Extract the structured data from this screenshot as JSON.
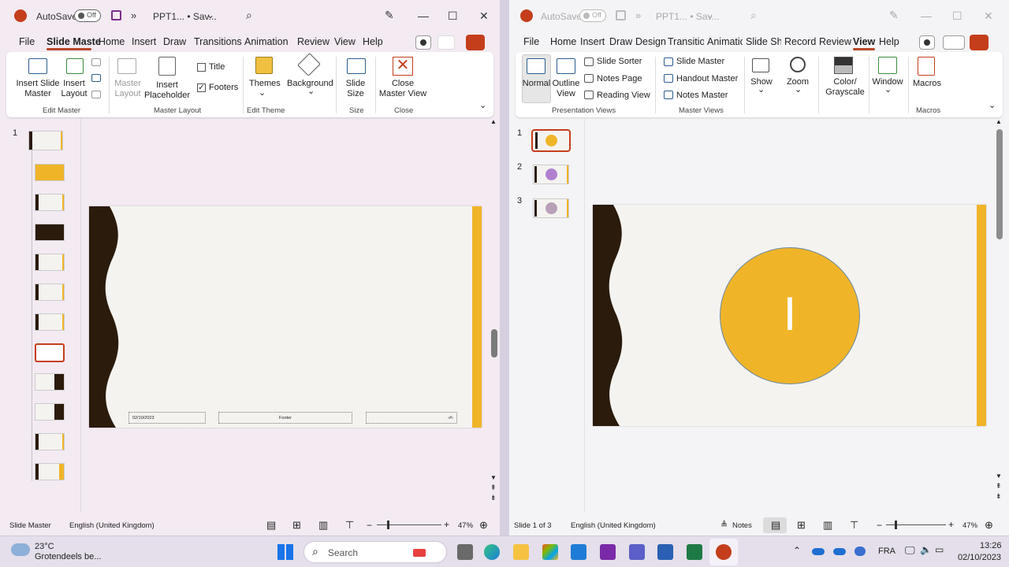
{
  "left": {
    "title": {
      "autosave": "AutoSave",
      "toggle": "Off",
      "doc": "PPT1... • Sav..."
    },
    "tabs": [
      "File",
      "Slide Maste",
      "Home",
      "Insert",
      "Draw",
      "Transitions",
      "Animations",
      "Review",
      "View",
      "Help"
    ],
    "ribbon": {
      "insert_slide_master": "Insert Slide Master",
      "insert_layout": "Insert Layout",
      "master_layout": "Master Layout",
      "insert_placeholder": "Insert Placeholder",
      "title_check": "Title",
      "footers_check": "Footers",
      "themes": "Themes",
      "background": "Background",
      "slide_size": "Slide Size",
      "close_master": "Close Master View",
      "groups": {
        "edit_master": "Edit Master",
        "master_layout": "Master Layout",
        "edit_theme": "Edit Theme",
        "size": "Size",
        "close": "Close"
      }
    },
    "slide_number": "1",
    "slide": {
      "date": "02/10/2023",
      "footer": "Footer",
      "page": "‹#›"
    },
    "status": {
      "slide": "Slide Master",
      "lang": "English (United Kingdom)",
      "zoom": "47%"
    }
  },
  "right": {
    "title": {
      "autosave": "AutoSave",
      "toggle": "Off",
      "doc": "PPT1... • Sav..."
    },
    "tabs": [
      "File",
      "Home",
      "Insert",
      "Draw",
      "Design",
      "Transitio",
      "Animatic",
      "Slide Sho",
      "Record",
      "Review",
      "View",
      "Help"
    ],
    "ribbon": {
      "normal": "Normal",
      "outline_view": "Outline View",
      "slide_sorter": "Slide Sorter",
      "notes_page": "Notes Page",
      "reading_view": "Reading View",
      "slide_master": "Slide Master",
      "handout_master": "Handout Master",
      "notes_master": "Notes Master",
      "show": "Show",
      "zoom": "Zoom",
      "color": "Color/ Grayscale",
      "window": "Window",
      "macros": "Macros",
      "groups": {
        "presentation_views": "Presentation Views",
        "master_views": "Master Views",
        "macros": "Macros"
      }
    },
    "slide_numbers": [
      "1",
      "2",
      "3"
    ],
    "circle_text": "I",
    "status": {
      "slide": "Slide 1 of 3",
      "lang": "English (United Kingdom)",
      "notes": "Notes",
      "zoom": "47%"
    }
  },
  "taskbar": {
    "temp": "23°C",
    "weather": "Grotendeels be...",
    "search": "Search",
    "lang": "FRA",
    "time": "13:26",
    "date": "02/10/2023"
  },
  "colors": {
    "accent": "#b7472a",
    "gold": "#f0b429",
    "dark": "#2a1b0c",
    "purple": "#b07fcf"
  }
}
